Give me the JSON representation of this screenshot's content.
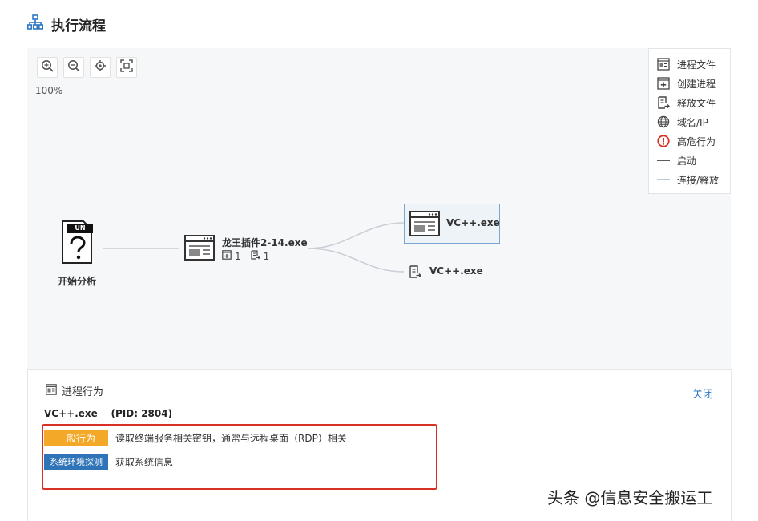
{
  "header": {
    "title": "执行流程",
    "icon": "org-chart-icon",
    "accent": "#2f78c4"
  },
  "canvas": {
    "zoom": "100%",
    "toolbar": [
      {
        "name": "zoom-in-icon"
      },
      {
        "name": "zoom-out-icon"
      },
      {
        "name": "locate-icon"
      },
      {
        "name": "fit-screen-icon"
      }
    ],
    "legend": [
      {
        "icon": "process-file-icon",
        "label": "进程文件"
      },
      {
        "icon": "create-process-icon",
        "label": "创建进程"
      },
      {
        "icon": "release-file-icon",
        "label": "释放文件"
      },
      {
        "icon": "globe-icon",
        "label": "域名/IP"
      },
      {
        "icon": "alert-icon",
        "label": "高危行为",
        "color": "#d93025"
      },
      {
        "icon": "line-dark-icon",
        "label": "启动"
      },
      {
        "icon": "line-light-icon",
        "label": "连接/释放"
      }
    ],
    "nodes": {
      "start": {
        "badge": "UN",
        "symbol": "?",
        "label": "开始分析"
      },
      "main": {
        "label": "龙王插件2-14.exe",
        "create_count": "1",
        "release_count": "1"
      },
      "child_process": {
        "label": "VC++.exe"
      },
      "child_file": {
        "label": "VC++.exe"
      }
    }
  },
  "panel": {
    "title": "进程行为",
    "close": "关闭",
    "process_name": "VC++.exe",
    "pid": "(PID: 2804)",
    "behaviors": [
      {
        "tag": "一般行为",
        "text": "读取终端服务相关密钥，通常与远程桌面（RDP）相关",
        "color": "#f3a827"
      },
      {
        "tag": "系统环境探测",
        "text": "获取系统信息",
        "color": "#2f73b8"
      }
    ],
    "highlight_color": "#d93025"
  },
  "watermark": "头条 @信息安全搬运工"
}
